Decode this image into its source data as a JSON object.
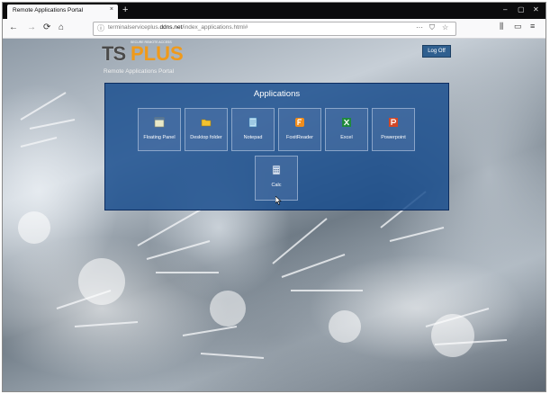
{
  "browser": {
    "tab_title": "Remote Applications Portal",
    "tab_close": "×",
    "new_tab": "+",
    "window_controls": [
      "–",
      "▢",
      "✕"
    ],
    "url_prefix": "terminalserviceplus.",
    "url_domain": "ddns.net",
    "url_path": "/index_applications.html#",
    "url_more": "···",
    "nav": {
      "back": "←",
      "forward": "→",
      "reload": "⟳",
      "home": "⌂"
    },
    "toolbar_right": [
      "⫼",
      "▭",
      "≡"
    ]
  },
  "portal": {
    "logo_ts": "TS",
    "logo_plus": "PLUS",
    "logo_tagline": "SECURE REMOTE ACCESS",
    "subtitle": "Remote Applications Portal",
    "logoff_label": "Log Off",
    "panel_title": "Applications",
    "apps": [
      {
        "label": "Floating Panel",
        "icon": "floating-panel-icon",
        "color": "#e8e8c8"
      },
      {
        "label": "Desktop folder",
        "icon": "folder-icon",
        "color": "#f2c230"
      },
      {
        "label": "Notepad",
        "icon": "notepad-icon",
        "color": "#7fc4e8"
      },
      {
        "label": "FoxitReader",
        "icon": "foxit-icon",
        "color": "#f08c1a"
      },
      {
        "label": "Excel",
        "icon": "excel-icon",
        "color": "#1f8a3c"
      },
      {
        "label": "Powerpoint",
        "icon": "powerpoint-icon",
        "color": "#d24726"
      },
      {
        "label": "Calc",
        "icon": "calculator-icon",
        "color": "#9ab4d6"
      }
    ]
  }
}
